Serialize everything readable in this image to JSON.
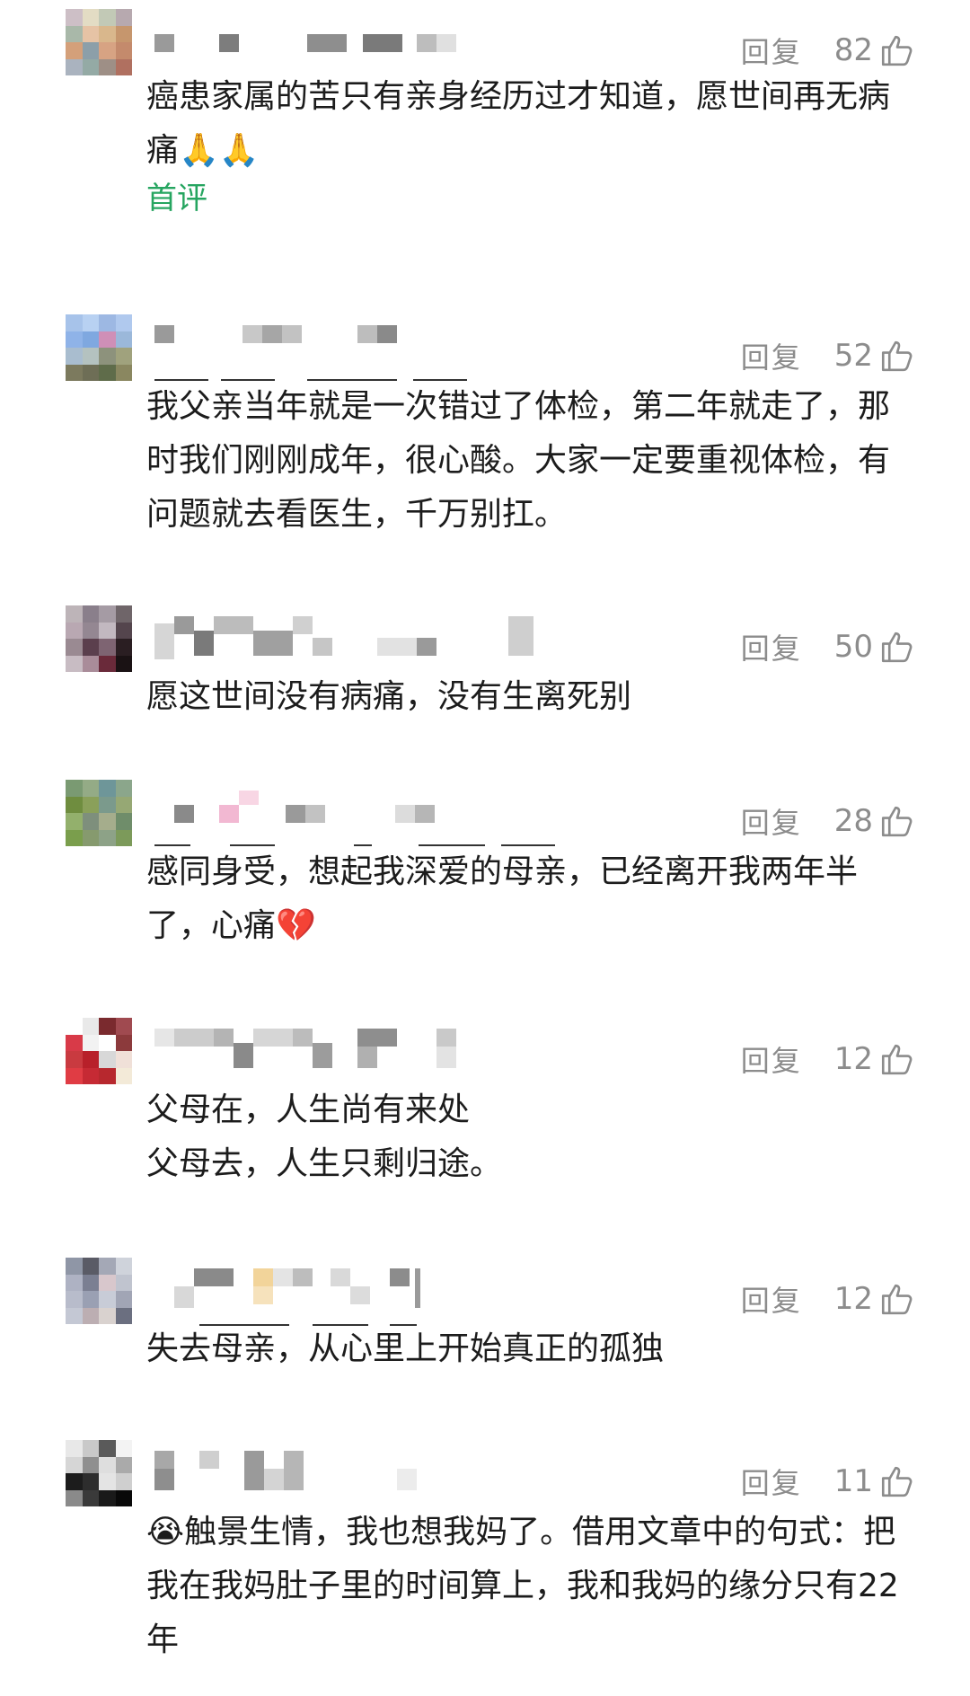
{
  "comments": [
    {
      "reply": "回复",
      "likes": "82",
      "text": "癌患家属的苦只有亲身经历过才知道，愿世间再无病痛🙏🙏",
      "tag": "首评",
      "avatar": [
        "#cdbfc6",
        "#e3dcc4",
        "#c2c9b6",
        "#b7a9af",
        "#a9b8a9",
        "#e6c3a5",
        "#d9b78c",
        "#c6966d",
        "#d4a07a",
        "#8c9fa9",
        "#d7a383",
        "#c48a6c",
        "#aab3bf",
        "#94aaa5",
        "#9e8f86",
        "#b07060"
      ]
    },
    {
      "reply": "回复",
      "likes": "52",
      "text": "我父亲当年就是一次错过了体检，第二年就走了，那时我们刚刚成年，很心酸。大家一定要重视体检，有问题就去看医生，千万别扛。",
      "avatar": [
        "#a7c3ea",
        "#b8d1f2",
        "#9db8e3",
        "#b0c9ee",
        "#8fb3e8",
        "#7fa8e0",
        "#cf8fb7",
        "#9bb8da",
        "#a9bdcf",
        "#b4c2c0",
        "#8d927c",
        "#a0a27d",
        "#7c7a5e",
        "#6e6e56",
        "#5f6c4a",
        "#8a8760"
      ]
    },
    {
      "reply": "回复",
      "likes": "50",
      "text": "愿这世间没有病痛，没有生离死别",
      "avatar": [
        "#bdb4b8",
        "#8a7f8b",
        "#a59ba4",
        "#6f6569",
        "#b9a8b2",
        "#948792",
        "#c2b8c0",
        "#54454d",
        "#9a8a92",
        "#5b3f4d",
        "#7e6472",
        "#2a1e22",
        "#c8bcc3",
        "#a98c99",
        "#6a2a3a",
        "#1a1214"
      ]
    },
    {
      "reply": "回复",
      "likes": "28",
      "text": "感同身受，想起我深爱的母亲，已经离开我两年半了，心痛💔",
      "avatar": [
        "#7a9a72",
        "#94ab86",
        "#6e9699",
        "#8ba68b",
        "#6f8d3f",
        "#8aa05a",
        "#7b9a8c",
        "#96a874",
        "#93b06c",
        "#7e8f7c",
        "#a5ad8c",
        "#6f8d6a",
        "#7a9e4c",
        "#869a6e",
        "#8da287",
        "#7c9a5a"
      ]
    },
    {
      "reply": "回复",
      "likes": "12",
      "text": "父母在，人生尚有来处\n父母去，人生只剩归途。",
      "avatar": [
        "#ffffff",
        "#e9e9e9",
        "#7a2a2e",
        "#a04a50",
        "#d83a48",
        "#f2f2f2",
        "#ffffff",
        "#8c3a3c",
        "#c93a40",
        "#b8202a",
        "#d8d8d8",
        "#f0e0d8",
        "#e03c44",
        "#c62a34",
        "#b7282e",
        "#f3ead8"
      ]
    },
    {
      "reply": "回复",
      "likes": "12",
      "text": "失去母亲，从心里上开始真正的孤独",
      "avatar": [
        "#8f96a6",
        "#5a5b66",
        "#a4a8b6",
        "#cfd3db",
        "#aeb2c3",
        "#7b7f92",
        "#d8c7cc",
        "#c0c4cf",
        "#b8bccb",
        "#9aa0b3",
        "#c8ccd7",
        "#a1a5b5",
        "#c4c8d4",
        "#bcaeb2",
        "#d9d2cf",
        "#6b6f80"
      ]
    },
    {
      "reply": "回复",
      "likes": "11",
      "text": "😭触景生情，我也想我妈了。借用文章中的句式：把我在我妈肚子里的时间算上，我和我妈的缘分只有22年",
      "avatar": [
        "#e8e8e8",
        "#c9c9c9",
        "#5a5a5a",
        "#f3f3f3",
        "#d6d6d6",
        "#8f8f8f",
        "#dedede",
        "#aaaaaa",
        "#1c1c1c",
        "#2d2d2d",
        "#e4e4e4",
        "#cfcfcf",
        "#8a8a8a",
        "#3a3a3a",
        "#1a1a1a",
        "#090909"
      ]
    }
  ]
}
